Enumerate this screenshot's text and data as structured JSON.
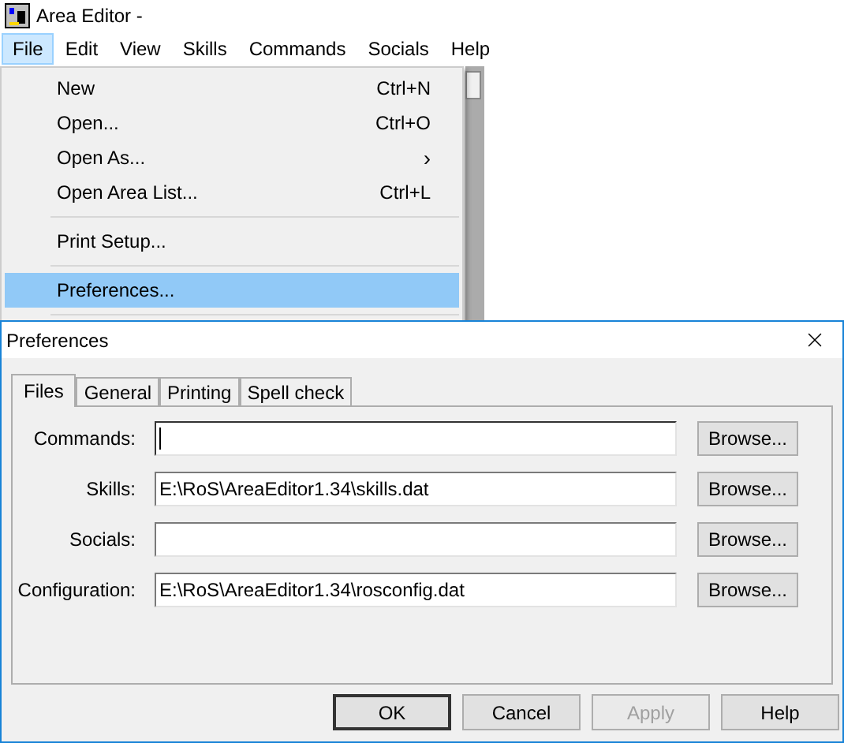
{
  "app_window": {
    "title": "Area Editor -",
    "menu_bar": [
      {
        "label": "File",
        "selected": true
      },
      {
        "label": "Edit",
        "selected": false
      },
      {
        "label": "View",
        "selected": false
      },
      {
        "label": "Skills",
        "selected": false
      },
      {
        "label": "Commands",
        "selected": false
      },
      {
        "label": "Socials",
        "selected": false
      },
      {
        "label": "Help",
        "selected": false
      }
    ],
    "file_menu": [
      {
        "kind": "item",
        "label": "New",
        "shortcut": "Ctrl+N",
        "selected": false
      },
      {
        "kind": "item",
        "label": "Open...",
        "shortcut": "Ctrl+O",
        "selected": false
      },
      {
        "kind": "submenu",
        "label": "Open As...",
        "arrow": "›",
        "selected": false
      },
      {
        "kind": "item",
        "label": "Open Area List...",
        "shortcut": "Ctrl+L",
        "selected": false
      },
      {
        "kind": "separator"
      },
      {
        "kind": "item",
        "label": "Print Setup...",
        "selected": false
      },
      {
        "kind": "separator"
      },
      {
        "kind": "item",
        "label": "Preferences...",
        "selected": true
      },
      {
        "kind": "separator"
      }
    ]
  },
  "dialog": {
    "title": "Preferences",
    "tabs": [
      {
        "label": "Files",
        "selected": true
      },
      {
        "label": "General",
        "selected": false
      },
      {
        "label": "Printing",
        "selected": false
      },
      {
        "label": "Spell check",
        "selected": false
      }
    ],
    "fields": [
      {
        "label": "Commands:",
        "focused": true,
        "button": "Browse..."
      },
      {
        "label": "Skills:",
        "value": "E:\\RoS\\AreaEditor1.34\\skills.dat",
        "focused": false,
        "button": "Browse..."
      },
      {
        "label": "Socials:",
        "focused": false,
        "button": "Browse..."
      },
      {
        "label": "Configuration:",
        "value": "E:\\RoS\\AreaEditor1.34\\rosconfig.dat",
        "focused": false,
        "button": "Browse..."
      }
    ],
    "buttons": [
      {
        "label": "OK",
        "default": true,
        "disabled": false
      },
      {
        "label": "Cancel",
        "default": false,
        "disabled": false
      },
      {
        "label": "Apply",
        "default": false,
        "disabled": true
      },
      {
        "label": "Help",
        "default": false,
        "disabled": false
      }
    ]
  }
}
